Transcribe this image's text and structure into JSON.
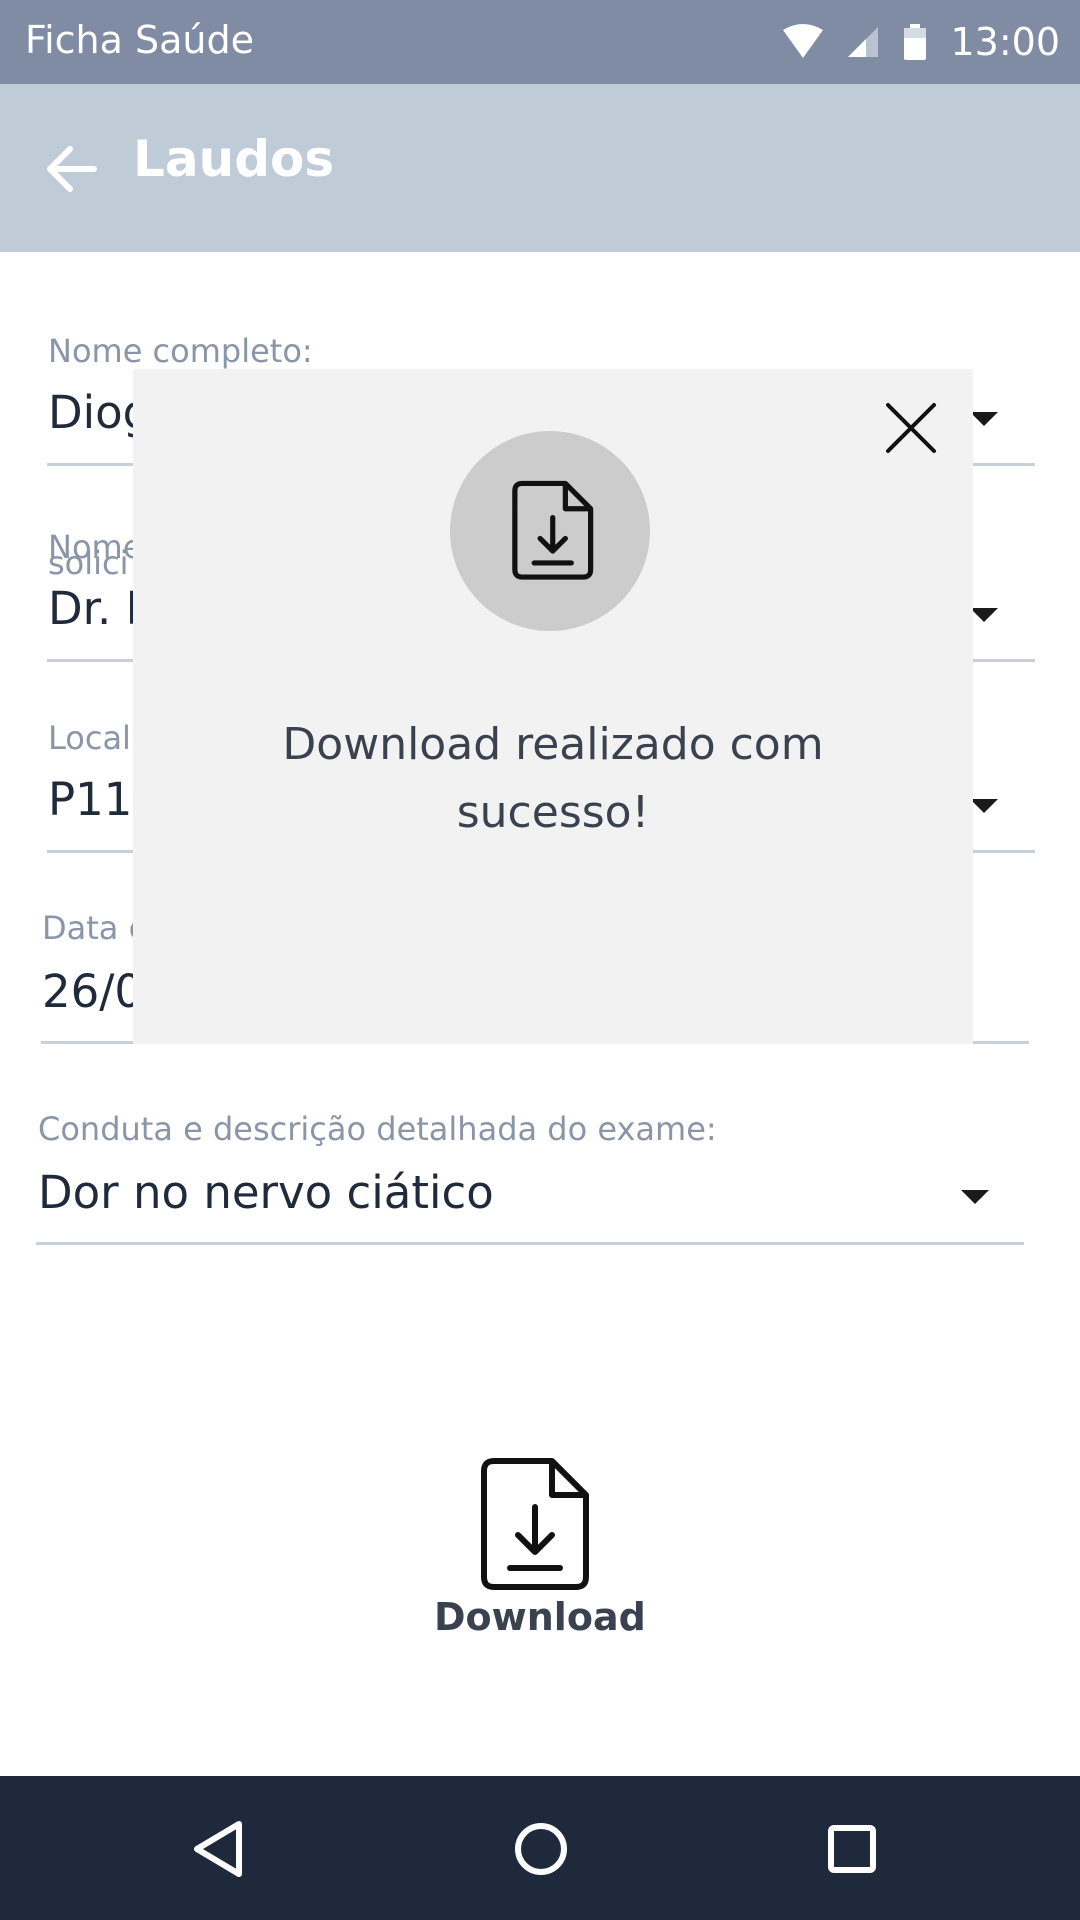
{
  "status_bar": {
    "app_name": "Ficha Saúde",
    "time": "13:00"
  },
  "app_bar": {
    "title": "Laudos"
  },
  "form": {
    "fields": [
      {
        "label": "Nome completo:",
        "value": "Diog"
      },
      {
        "label": "Nome",
        "label_overlap": "solici",
        "value": "Dr. F"
      },
      {
        "label": "Local",
        "value": "P11"
      },
      {
        "label": "Data c",
        "value": "26/0"
      },
      {
        "label": "Conduta e descrição detalhada do exame:",
        "value": "Dor no nervo ciático"
      }
    ]
  },
  "download": {
    "label": "Download",
    "icon": "file-download-icon"
  },
  "modal": {
    "message": "Download realizado com sucesso!",
    "icon": "file-download-icon",
    "close_icon": "close-icon"
  },
  "nav_bar": {
    "back": "back-triangle-icon",
    "home": "home-circle-icon",
    "recents": "recents-square-icon"
  },
  "colors": {
    "status_bar": "#7f8ca3",
    "app_bar": "#c0cbd8",
    "nav_bar": "#1e2a3b",
    "modal_bg": "#f2f2f2"
  }
}
